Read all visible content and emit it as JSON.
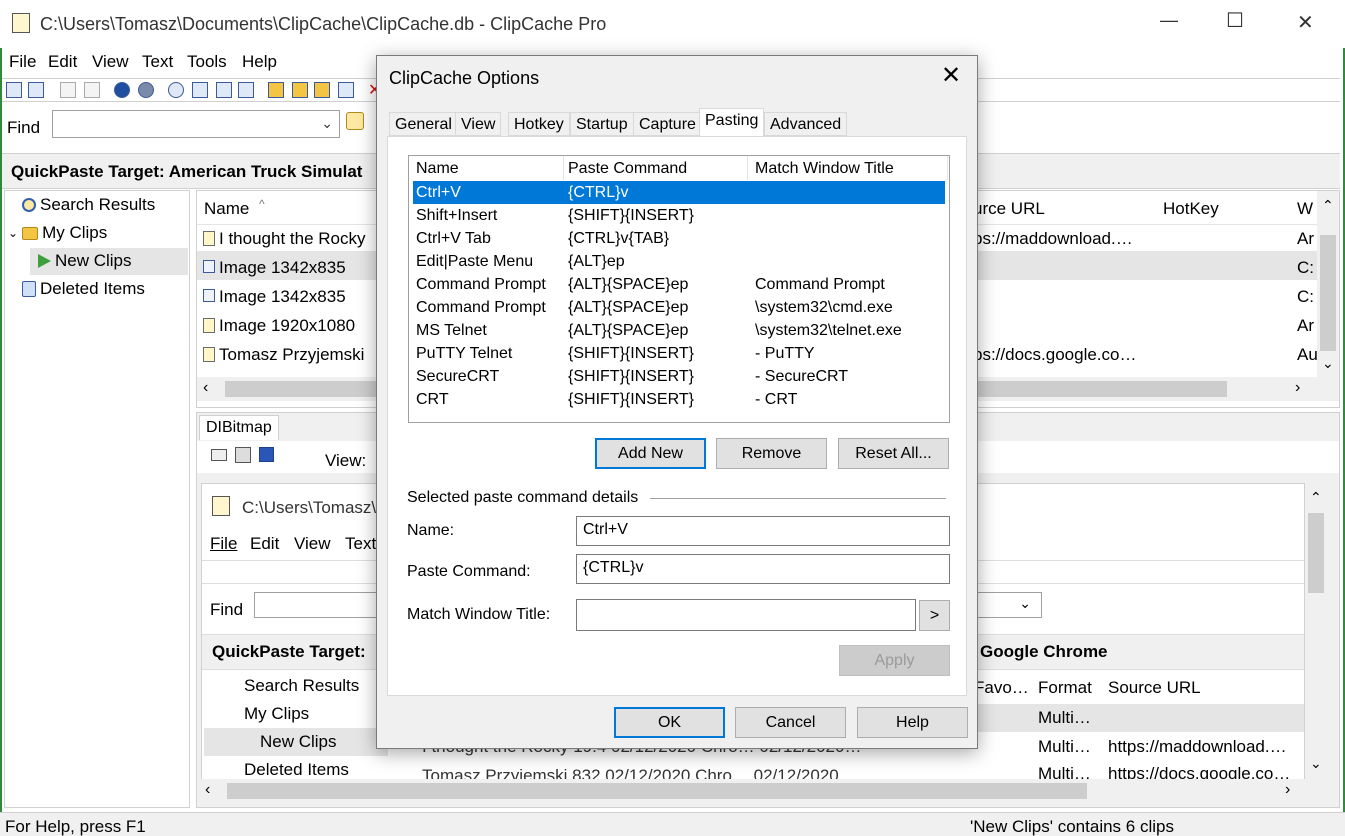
{
  "window": {
    "title": "C:\\Users\\Tomasz\\Documents\\ClipCache\\ClipCache.db - ClipCache Pro",
    "min_glyph": "—",
    "max_glyph": "☐",
    "close_glyph": "✕"
  },
  "menu": [
    "File",
    "Edit",
    "View",
    "Text",
    "Tools",
    "Help"
  ],
  "find": {
    "label": "Find",
    "value": ""
  },
  "quickpaste_target": "QuickPaste Target: American Truck Simulat",
  "tree": {
    "search_results": "Search Results",
    "my_clips": "My Clips",
    "new_clips": "New Clips",
    "deleted_items": "Deleted Items"
  },
  "clip_list": {
    "columns": {
      "name": "Name",
      "source_url": "urce URL",
      "hotkey": "HotKey",
      "w": "W"
    },
    "rows": [
      {
        "name": "I thought the Rocky",
        "url": "ps://maddownload.…",
        "w": "Ar"
      },
      {
        "name": "Image 1342x835",
        "url": "",
        "w": "C:"
      },
      {
        "name": "Image 1342x835",
        "url": "",
        "w": "C:"
      },
      {
        "name": "Image 1920x1080",
        "url": "",
        "w": "Ar"
      },
      {
        "name": "Tomasz Przyjemski",
        "url": "ps://docs.google.co…",
        "w": "Au"
      }
    ]
  },
  "preview": {
    "tab": "DIBitmap",
    "view_label": "View:",
    "inner_title": "C:\\Users\\Tomasz\\",
    "inner_menu": [
      "File",
      "Edit",
      "View",
      "Text"
    ],
    "inner_find": "Find",
    "inner_qp": "QuickPaste Target:",
    "inner_qp_right": "Google Chrome",
    "inner_tree": [
      "Search Results",
      "My Clips",
      "New Clips",
      "Deleted Items"
    ],
    "inner_cols": [
      "Favo…",
      "Format",
      "Source URL"
    ],
    "inner_rows": [
      {
        "format": "Multi…",
        "url": ""
      },
      {
        "format": "Multi…",
        "url": "https://maddownload.…"
      },
      {
        "format": "Multi…",
        "url": "https://docs.google.co…"
      }
    ],
    "inner_row_partial_1": "I thought the Rocky  19.4  02/12/2020  Chro…  02/12/2020…",
    "inner_row_partial_2": "Tomasz Przyjemski     832   02/12/2020  Chro…  02/12/2020"
  },
  "status": {
    "left": "For Help, press F1",
    "right": "'New Clips' contains 6 clips"
  },
  "dialog": {
    "title": "ClipCache Options",
    "close": "✕",
    "tabs": [
      "General",
      "View",
      "Hotkey",
      "Startup",
      "Capture",
      "Pasting",
      "Advanced"
    ],
    "active_tab": "Pasting",
    "list_headers": [
      "Name",
      "Paste Command",
      "Match Window Title"
    ],
    "list_rows": [
      {
        "name": "Ctrl+V",
        "cmd": "{CTRL}v",
        "match": ""
      },
      {
        "name": "Shift+Insert",
        "cmd": "{SHIFT}{INSERT}",
        "match": ""
      },
      {
        "name": "Ctrl+V Tab",
        "cmd": "{CTRL}v{TAB}",
        "match": ""
      },
      {
        "name": "Edit|Paste Menu",
        "cmd": "{ALT}ep",
        "match": ""
      },
      {
        "name": "Command Prompt",
        "cmd": "{ALT}{SPACE}ep",
        "match": "Command Prompt"
      },
      {
        "name": "Command Prompt",
        "cmd": "{ALT}{SPACE}ep",
        "match": "\\system32\\cmd.exe"
      },
      {
        "name": "MS Telnet",
        "cmd": "{ALT}{SPACE}ep",
        "match": "\\system32\\telnet.exe"
      },
      {
        "name": "PuTTY Telnet",
        "cmd": "{SHIFT}{INSERT}",
        "match": "- PuTTY"
      },
      {
        "name": "SecureCRT",
        "cmd": "{SHIFT}{INSERT}",
        "match": "- SecureCRT"
      },
      {
        "name": "CRT",
        "cmd": "{SHIFT}{INSERT}",
        "match": "- CRT"
      }
    ],
    "add_new": "Add New",
    "remove": "Remove",
    "reset_all": "Reset All...",
    "details_label": "Selected paste command details",
    "name_label": "Name:",
    "name_value": "Ctrl+V",
    "cmd_label": "Paste Command:",
    "cmd_value": "{CTRL}v",
    "match_label": "Match Window Title:",
    "match_value": "",
    "arrow": ">",
    "apply": "Apply",
    "ok": "OK",
    "cancel": "Cancel",
    "help": "Help"
  },
  "colors": {
    "selection": "#0078d7",
    "border_green": "#2e8b3a"
  }
}
